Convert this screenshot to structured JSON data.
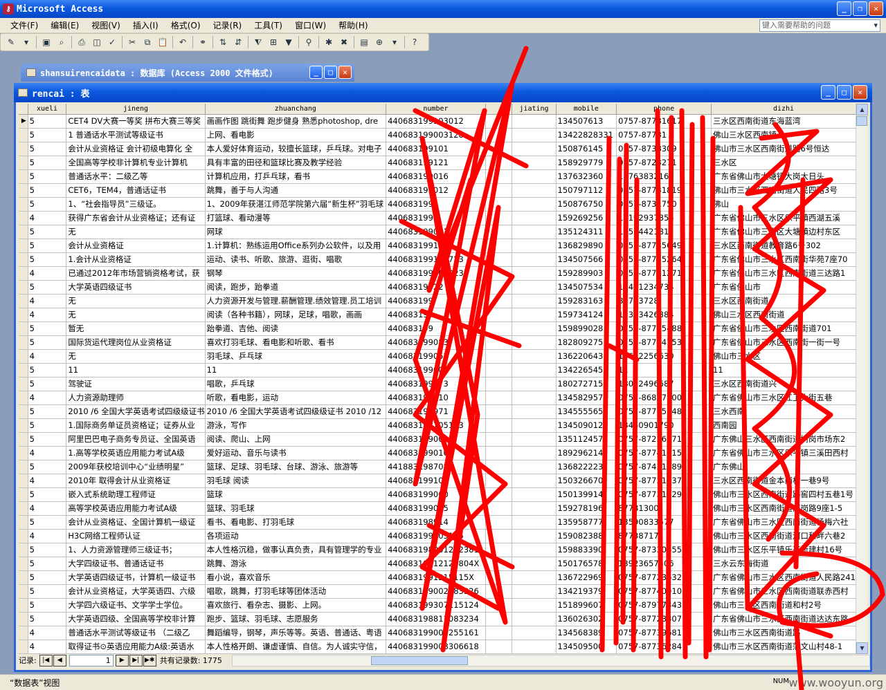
{
  "app": {
    "title": "Microsoft Access"
  },
  "menu": [
    "文件(F)",
    "编辑(E)",
    "视图(V)",
    "插入(I)",
    "格式(O)",
    "记录(R)",
    "工具(T)",
    "窗口(W)",
    "帮助(H)"
  ],
  "help_box": {
    "placeholder": "键入需要帮助的问题"
  },
  "db_window": {
    "title": "shansuirencaidata : 数据库 (Access 2000 文件格式)"
  },
  "table_window": {
    "title": "rencai : 表"
  },
  "columns": [
    "xueli",
    "jineng",
    "zhuanchang",
    "number",
    "jiating",
    "mobile",
    "phone",
    "dizhi"
  ],
  "rows": [
    [
      "5",
      "CET4 DV大赛一等奖 拼布大赛三等奖",
      "画画作图 跳街舞 跑步健身 熟悉photoshop, dre",
      "440683199103012",
      "",
      "134507613",
      "0757-87731617",
      "三水区西南街道东海蓝湾"
    ],
    [
      "5",
      "1 普通话水平测试等级证书",
      "上网、看电影",
      "440683199003128",
      "",
      "13422828331",
      "0757-87731",
      "佛山三水区西南镇"
    ],
    [
      "5",
      "会计从业资格证 会计初级电算化 全",
      "本人爱好体育运动，较擅长篮球，乒乓球。对电子",
      "440683199101",
      "",
      "150876145",
      "0757-8738309",
      "佛山市三水区西南街道路6号恒达"
    ],
    [
      "5",
      "全国高等学校非计算机专业计算机",
      "具有丰富的田径和篮球比赛及教学经验",
      "440683199121",
      "",
      "158929779",
      "0757-8723271",
      "三水区"
    ],
    [
      "5",
      "普通话水平：二级乙等",
      "计算机应用，打乒乓球，看书",
      "440683199016",
      "",
      "137632360",
      "13763832160",
      "广东省佛山市大塘镇大岗大日头"
    ],
    [
      "5",
      "CET6，TEM4，普通话证书",
      "跳舞，善于与人沟通",
      "440683199012",
      "",
      "150797112",
      "0757-87731819",
      "佛山市三水区西南街道人民四路3号"
    ],
    [
      "5",
      "1、“社会指导员”三级证。",
      "1、2009年获湛江师范学院第六届“新生杯”羽毛球",
      "440683199",
      "",
      "150876750",
      "0757-8731750",
      "佛山"
    ],
    [
      "4",
      "获得广东省会计从业资格证；还有证",
      "打篮球、看动漫等",
      "440683199",
      "",
      "159269256",
      "13192937856",
      "广东省佛山市三水区乐平镇西湖五溪"
    ],
    [
      "5",
      "无",
      "网球",
      "440683199011",
      "",
      "135124311",
      "13524421811",
      "广东省佛山市三水区大塘镇边村东区"
    ],
    [
      "5",
      "会计从业资格证",
      "1.计算机：熟练运用Office系列办公软件，以及用",
      "440683199121",
      "",
      "136829890",
      "0757-87735649",
      "三水区西南街道教育路6号302"
    ],
    [
      "5",
      "1.会计从业资格证",
      "运动、读书、听歌、旅游、逛街、唱歌",
      "440683199123723",
      "",
      "134507566",
      "0757-87735264",
      "广东省佛山市三水区西南街华苑7座70"
    ],
    [
      "4",
      "已通过2012年市场营销资格考试，获",
      "钢琴",
      "440683199208923",
      "",
      "159289903",
      "0757-87731271",
      "广东省佛山市三水区西南街道三达路1"
    ],
    [
      "5",
      "大学英语四级证书",
      "阅读，跑步，跆拳道",
      "44068319922",
      "",
      "134507534",
      "13421234734",
      "广东省佛山市"
    ],
    [
      "4",
      "无",
      "人力资源开发与管理.薪酬管理.绩效管理.员工培训",
      "440683199",
      "",
      "159283163",
      "87783728",
      "三水区西南街道"
    ],
    [
      "4",
      "无",
      "阅读（各种书籍），网球，足球，唱歌，画画",
      "440683199",
      "",
      "159734124",
      "15343426884",
      "佛山三水区西南街道"
    ],
    [
      "5",
      "暂无",
      "跆拳道、吉他、阅读",
      "440683199",
      "",
      "159899028",
      "0757-87735488",
      "广东省佛山市三水区西南街道701"
    ],
    [
      "5",
      "国际货运代理岗位从业资格证",
      "喜欢打羽毛球、看电影和听歌、看书",
      "440683199083",
      "",
      "182809275",
      "0757-87744753",
      "广东省佛山市三水区西南街一街一号"
    ],
    [
      "4",
      "无",
      "羽毛球、乒乓球",
      "440681199052",
      "",
      "136220643",
      "13622256630",
      "佛山市三水区"
    ],
    [
      "5",
      "11",
      "11",
      "440683199000",
      "",
      "134226545",
      "11",
      "11"
    ],
    [
      "5",
      "驾驶证",
      "唱歌，乒乓球",
      "440683199373",
      "",
      "180272715",
      "18022496687",
      "三水区西南街道兴"
    ],
    [
      "4",
      "人力资源助理师",
      "听歌，看电影，运动",
      "440683199610",
      "",
      "134582957",
      "0757-86887700",
      "广东省佛山市三水区江卫大街五巷"
    ],
    [
      "5",
      "2010 /6 全国大学英语考试四级级证书",
      "2010 /6 全国大学英语考试四级级证书 2010 /12",
      "440683199971",
      "",
      "134555565",
      "0757-87735848",
      "三水西南"
    ],
    [
      "5",
      "1.国际商务单证员资格证；证券从业",
      "游泳，写作",
      "440683198705123",
      "",
      "134509012",
      "13450901790",
      "西南园"
    ],
    [
      "5",
      "阿里巴巴电子商务专员证、全国英语",
      "阅读、爬山、上网",
      "440683199003",
      "",
      "135112457",
      "0757-87236671",
      "广东佛山三水区西南街道树岗市场东2"
    ],
    [
      "4",
      "1.高等学校英语应用能力考试A级",
      "爱好运动、音乐与读书",
      "440683199010",
      "",
      "189296214",
      "0757-87741115",
      "广东省佛山市三水区乐平镇三溪田西村"
    ],
    [
      "5",
      "2009年获校培训中心“业绩明星”",
      "篮球、足球、羽毛球、台球、游泳、旅游等",
      "441883198708",
      "",
      "136822223",
      "0757-87431089",
      "广东佛山"
    ],
    [
      "4",
      "2010年 取得会计从业资格证",
      "羽毛球 阅读",
      "440683199101",
      "",
      "150326670",
      "0757-87731837",
      "三水区西南街道金本岗村一巷9号"
    ],
    [
      "5",
      "嵌入式系统助理工程师证",
      "篮球",
      "440683199060",
      "",
      "150139914",
      "0757-87731129",
      "佛山市三水区西南街道路窖四村五巷1号"
    ],
    [
      "4",
      "高等学校英语应用能力考试A级",
      "篮球、羽毛球",
      "440683199005",
      "",
      "159278196",
      "87781300",
      "佛山市三水区西南街道南岗路9座1-5"
    ],
    [
      "5",
      "会计从业资格证、全国计算机一级证",
      "看书、看电影、打羽毛球",
      "440683198914",
      "",
      "135958777",
      "13590833577",
      "广东省佛山市三水区西南街道杨梅六社"
    ],
    [
      "4",
      "H3C网络工程师认证",
      "各项运动",
      "440683199003115",
      "",
      "159082388",
      "87738717",
      "佛山市三水区西南街道河口和畔六巷2"
    ],
    [
      "5",
      "1、人力资源管理师三级证书；",
      "本人性格沉稳，做事认真负责，具有管理学的专业",
      "440683198901232381",
      "",
      "159883390",
      "0757-87330655",
      "佛山市三水区乐平镇乐平新建村16号"
    ],
    [
      "5",
      "大学四级证书、普通话证书",
      "跳舞、游泳",
      "44068319912120804X",
      "",
      "150176578",
      "13923657506",
      "三水云东海街道"
    ],
    [
      "5",
      "大学英语四级证书，计算机一级证书",
      "看小说，喜欢音乐",
      "4406831991215115X",
      "",
      "136722969",
      "0757-87723632",
      "广东省佛山市三水区西南街道人民路241"
    ],
    [
      "5",
      "会计从业资格证，大学英语四、六级",
      "唱歌，跳舞，打羽毛球等团体活动",
      "440683199002083326",
      "",
      "134219379",
      "0757-87740910",
      "广东省佛山市三水区西南街道联赤西村"
    ],
    [
      "5",
      "大学四六级证书、文学学士学位。",
      "喜欢旅行、看杂志、摄影、上网。",
      "440683199307115124",
      "",
      "151899607",
      "0757-87977343",
      "佛山市三水区西南街道和村2号"
    ],
    [
      "5",
      "大学英语四级、全国高等学校非计算",
      "跑步、篮球、羽毛球、志愿服务",
      "440683198811083234",
      "",
      "136026302",
      "0757-87723307",
      "广东省佛山市三水区西南街道达达东路"
    ],
    [
      "4",
      "普通话水平测试等级证书 （二级乙",
      "舞蹈编导，钢琴，声乐等等。英语、普通话、粤语",
      "440683199003255161",
      "",
      "134568389",
      "0757-87739681",
      "佛山市三水区西南街道路"
    ],
    [
      "4",
      "取得证书⊙英语应用能力A级:英语水",
      "本人性格开朗、谦虚谨慎、自信。为人诚实守信，",
      "440683199008306618",
      "",
      "134509500",
      "0757-87736284",
      "佛山市三水区西南街道蒲文山村48-1"
    ]
  ],
  "navigator": {
    "label": "记录:",
    "current": "1",
    "total_label": "共有记录数: 1775"
  },
  "status": {
    "view": "“数据表”视图",
    "num": "NUM"
  },
  "watermark": "www.wooyun.org"
}
